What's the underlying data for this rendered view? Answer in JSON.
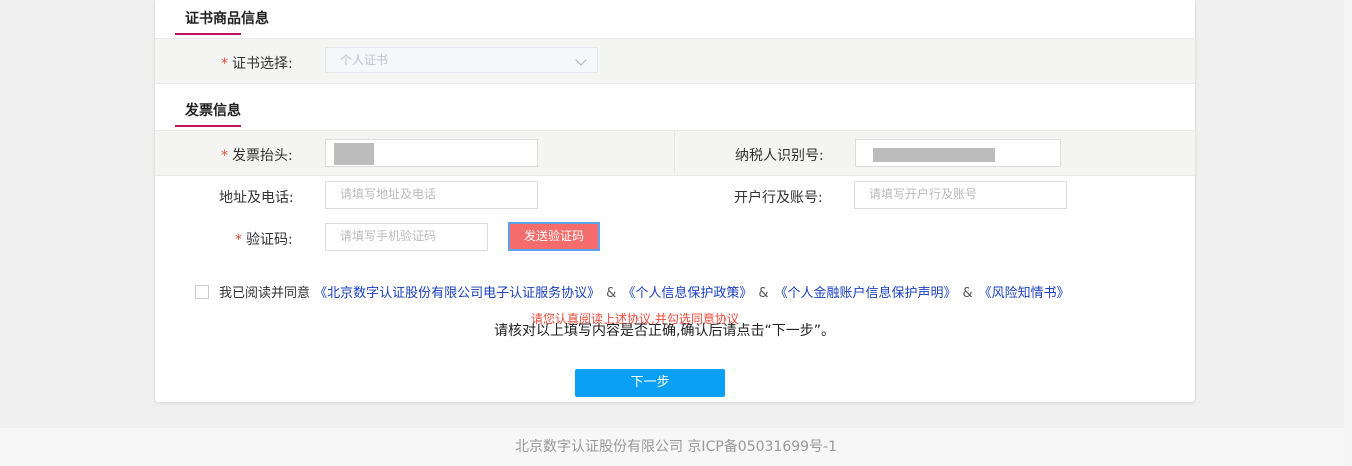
{
  "cert_section": {
    "title": "证书商品信息",
    "cert_select_label": "证书选择:",
    "cert_select_value": "个人证书"
  },
  "invoice_section": {
    "title": "发票信息",
    "invoice_title_label": "发票抬头:",
    "tax_id_label": "纳税人识别号:",
    "address_label": "地址及电话:",
    "address_placeholder": "请填写地址及电话",
    "bank_label": "开户行及账号:",
    "bank_placeholder": "请填写开户行及账号",
    "code_label": "验证码:",
    "code_placeholder": "请填写手机验证码",
    "send_code_button": "发送验证码"
  },
  "agreement": {
    "prefix": "我已阅读并同意",
    "amp": "&",
    "links": [
      "《北京数字认证股份有限公司电子认证服务协议》",
      "《个人信息保护政策》",
      "《个人金融账户信息保护声明》",
      "《风险知情书》"
    ],
    "warning": "请您认真阅读上述协议,并勾选同意协议",
    "confirm_text": "请核对以上填写内容是否正确,确认后请点击“下一步”。"
  },
  "next_button": "下一步",
  "footer": "北京数字认证股份有限公司 京ICP备05031699号-1",
  "required_mark": "*",
  "colors": {
    "accent": "#c0155e",
    "required": "#e84b3c",
    "primary_button": "#0aa0f5",
    "send_button": "#f56c6c",
    "link": "#1a3fbf"
  }
}
